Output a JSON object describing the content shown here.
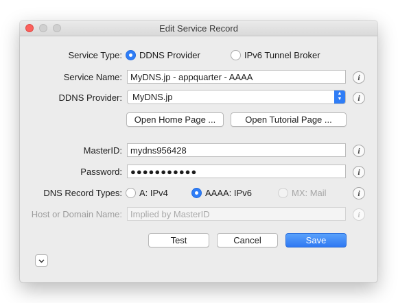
{
  "window": {
    "title": "Edit Service Record"
  },
  "service_type": {
    "label": "Service Type:",
    "options": [
      {
        "label": "DDNS Provider",
        "selected": true
      },
      {
        "label": "IPv6 Tunnel Broker",
        "selected": false
      }
    ]
  },
  "service_name": {
    "label": "Service Name:",
    "value": "MyDNS.jp - appquarter - AAAA"
  },
  "ddns_provider": {
    "label": "DDNS Provider:",
    "value": "MyDNS.jp"
  },
  "buttons": {
    "open_home": "Open Home Page ...",
    "open_tutorial": "Open Tutorial Page ...",
    "test": "Test",
    "cancel": "Cancel",
    "save": "Save"
  },
  "master_id": {
    "label": "MasterID:",
    "value": "mydns956428"
  },
  "password": {
    "label": "Password:",
    "value": "●●●●●●●●●●●"
  },
  "record_types": {
    "label": "DNS Record Types:",
    "options": [
      {
        "label": "A: IPv4",
        "selected": false,
        "enabled": true
      },
      {
        "label": "AAAA: IPv6",
        "selected": true,
        "enabled": true
      },
      {
        "label": "MX: Mail",
        "selected": false,
        "enabled": false
      }
    ]
  },
  "host_domain": {
    "label": "Host or Domain Name:",
    "placeholder": "Implied by MasterID",
    "enabled": false
  },
  "info_symbol": "i",
  "colors": {
    "accent": "#2f7df6",
    "close": "#fc605c",
    "window_bg": "#ececec"
  }
}
